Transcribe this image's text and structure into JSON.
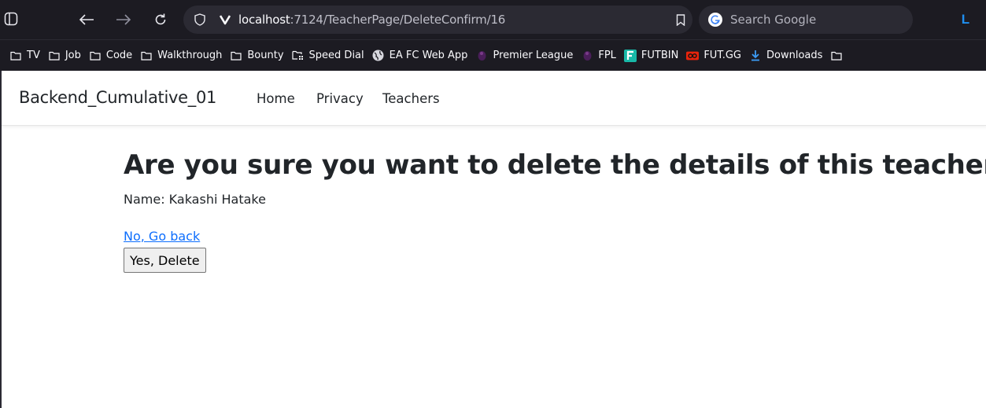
{
  "browser": {
    "url_host": "localhost",
    "url_rest": ":7124/TeacherPage/DeleteConfirm/16",
    "search_placeholder": "Search Google",
    "profile_initial": "L"
  },
  "bookmarks": [
    {
      "label": "TV",
      "icon": "folder-icon"
    },
    {
      "label": "Job",
      "icon": "folder-icon"
    },
    {
      "label": "Code",
      "icon": "folder-icon"
    },
    {
      "label": "Walkthrough",
      "icon": "folder-icon"
    },
    {
      "label": "Bounty",
      "icon": "folder-icon"
    },
    {
      "label": "Speed Dial",
      "icon": "speed-dial-icon"
    },
    {
      "label": "EA FC Web App",
      "icon": "globe-icon"
    },
    {
      "label": "Premier League",
      "icon": "premier-league-icon"
    },
    {
      "label": "FPL",
      "icon": "fpl-icon"
    },
    {
      "label": "FUTBIN",
      "icon": "futbin-icon"
    },
    {
      "label": "FUT.GG",
      "icon": "futgg-icon"
    },
    {
      "label": "Downloads",
      "icon": "download-icon"
    },
    {
      "label": "",
      "icon": "folder-icon"
    }
  ],
  "navbar": {
    "brand": "Backend_Cumulative_01",
    "links": [
      "Home",
      "Privacy",
      "Teachers"
    ]
  },
  "main": {
    "heading": "Are you sure you want to delete the details of this teacher?",
    "name_line": "Name: Kakashi Hatake",
    "back_link": "No, Go back",
    "delete_button": "Yes, Delete"
  },
  "colors": {
    "link": "#0d6efd",
    "chrome_bg": "#1c1b22",
    "urlbar_bg": "#2b2a33",
    "profile_accent": "#1f8ff0"
  }
}
